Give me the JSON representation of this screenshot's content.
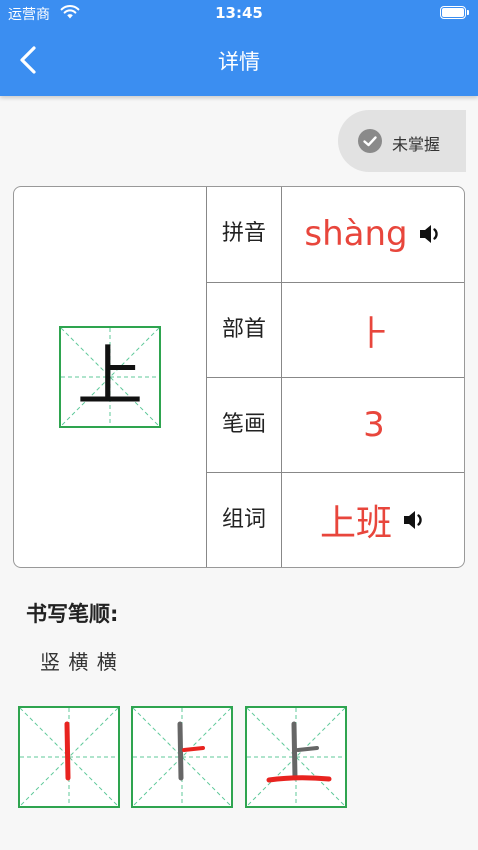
{
  "status_bar": {
    "carrier": "运营商",
    "time": "13:45"
  },
  "header": {
    "title": "详情",
    "back_icon": "chevron-left-icon"
  },
  "master_toggle": {
    "label": "未掌握",
    "icon": "check-circle-icon"
  },
  "character": {
    "char": "上"
  },
  "info": {
    "pinyin_label": "拼音",
    "pinyin_value": "shàng",
    "radical_label": "部首",
    "radical_value": "⺊",
    "strokes_label": "笔画",
    "strokes_value": "3",
    "word_label": "组词",
    "word_value": "上班"
  },
  "stroke_order": {
    "title": "书写笔顺:",
    "sequence": "竖 横 横"
  },
  "colors": {
    "header_blue": "#3b8ef1",
    "accent_red": "#e8463c",
    "grid_green": "#2ea44f"
  }
}
